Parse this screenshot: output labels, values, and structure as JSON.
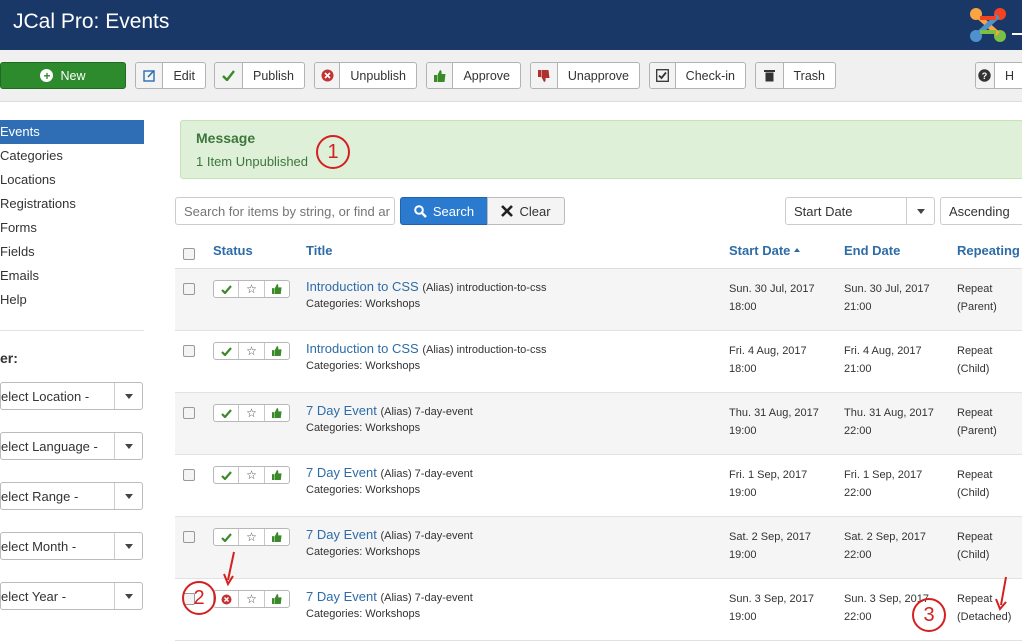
{
  "app": {
    "title": "JCal Pro: Events"
  },
  "toolbar": {
    "new": "New",
    "edit": "Edit",
    "publish": "Publish",
    "unpublish": "Unpublish",
    "approve": "Approve",
    "unapprove": "Unapprove",
    "checkin": "Check-in",
    "trash": "Trash",
    "help": "H"
  },
  "sidebar": {
    "items": [
      "Events",
      "Categories",
      "Locations",
      "Registrations",
      "Forms",
      "Fields",
      "Emails",
      "Help"
    ],
    "filter_title": "er:",
    "filters": [
      "elect Location -",
      "elect Language -",
      "elect Range -",
      "elect Month -",
      "elect Year -"
    ]
  },
  "message": {
    "heading": "Message",
    "body": "1 Item Unpublished"
  },
  "search": {
    "placeholder": "Search for items by string, or find ar",
    "search_label": "Search",
    "clear_label": "Clear"
  },
  "sorting": {
    "order_by": "Start Date",
    "direction": "Ascending"
  },
  "table": {
    "headers": {
      "status": "Status",
      "title": "Title",
      "start": "Start Date",
      "end": "End Date",
      "repeating": "Repeating"
    },
    "rows": [
      {
        "title": "Introduction to CSS",
        "alias": "(Alias) introduction-to-css",
        "category": "Categories: Workshops",
        "start_date": "Sun. 30 Jul, 2017",
        "start_time": "18:00",
        "end_date": "Sun. 30 Jul, 2017",
        "end_time": "21:00",
        "repeat": "Repeat",
        "repeat_type": "(Parent)",
        "published": true
      },
      {
        "title": "Introduction to CSS",
        "alias": "(Alias) introduction-to-css",
        "category": "Categories: Workshops",
        "start_date": "Fri. 4 Aug, 2017",
        "start_time": "18:00",
        "end_date": "Fri. 4 Aug, 2017",
        "end_time": "21:00",
        "repeat": "Repeat",
        "repeat_type": "(Child)",
        "published": true
      },
      {
        "title": "7 Day Event",
        "alias": "(Alias) 7-day-event",
        "category": "Categories: Workshops",
        "start_date": "Thu. 31 Aug, 2017",
        "start_time": "19:00",
        "end_date": "Thu. 31 Aug, 2017",
        "end_time": "22:00",
        "repeat": "Repeat",
        "repeat_type": "(Parent)",
        "published": true
      },
      {
        "title": "7 Day Event",
        "alias": "(Alias) 7-day-event",
        "category": "Categories: Workshops",
        "start_date": "Fri. 1 Sep, 2017",
        "start_time": "19:00",
        "end_date": "Fri. 1 Sep, 2017",
        "end_time": "22:00",
        "repeat": "Repeat",
        "repeat_type": "(Child)",
        "published": true
      },
      {
        "title": "7 Day Event",
        "alias": "(Alias) 7-day-event",
        "category": "Categories: Workshops",
        "start_date": "Sat. 2 Sep, 2017",
        "start_time": "19:00",
        "end_date": "Sat. 2 Sep, 2017",
        "end_time": "22:00",
        "repeat": "Repeat",
        "repeat_type": "(Child)",
        "published": true
      },
      {
        "title": "7 Day Event",
        "alias": "(Alias) 7-day-event",
        "category": "Categories: Workshops",
        "start_date": "Sun. 3 Sep, 2017",
        "start_time": "19:00",
        "end_date": "Sun. 3 Sep, 2017",
        "end_time": "22:00",
        "repeat": "Repeat",
        "repeat_type": "(Detached)",
        "published": false
      }
    ]
  },
  "annotations": [
    "1",
    "2",
    "3"
  ],
  "colors": {
    "header": "#1a3867",
    "accent": "#2f6eb5",
    "success_bg": "#dff0d8",
    "annotation": "#d42020"
  }
}
